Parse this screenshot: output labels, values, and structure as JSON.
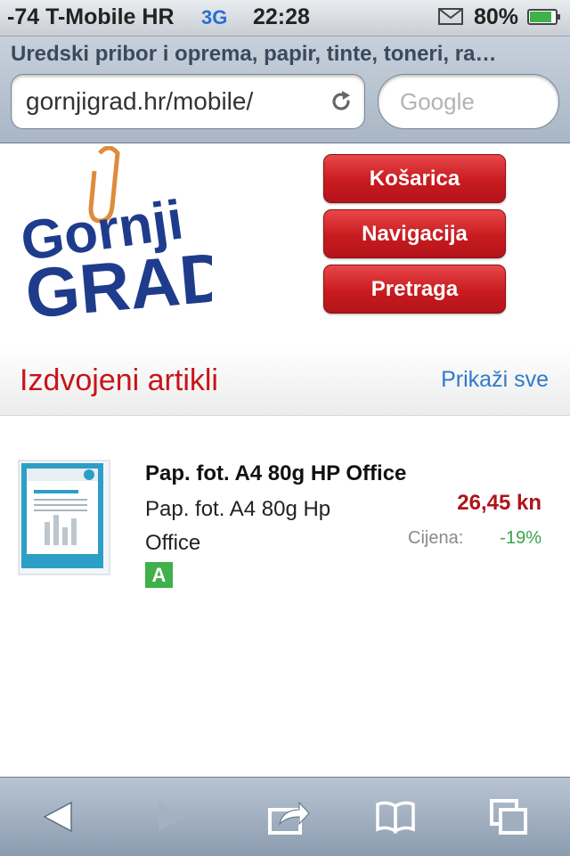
{
  "status_bar": {
    "carrier": "-74 T-Mobile HR",
    "network": "3G",
    "time": "22:28",
    "battery": "80%"
  },
  "browser": {
    "page_title": "Uredski pribor i oprema, papir, tinte, toneri, ra…",
    "url": "gornjigrad.hr/mobile/",
    "search_placeholder": "Google"
  },
  "header": {
    "logo_text": "Gornji GRAD",
    "buttons": [
      "Košarica",
      "Navigacija",
      "Pretraga"
    ]
  },
  "featured": {
    "title": "Izdvojeni artikli",
    "show_all": "Prikaži sve"
  },
  "products": [
    {
      "name": "Pap. fot. A4 80g HP Office",
      "description": "Pap. fot. A4 80g Hp Office",
      "price": "26,45 kn",
      "price_label": "Cijena:",
      "discount": "-19%",
      "badge": "A"
    }
  ],
  "colors": {
    "accent_red": "#c8141a",
    "link_blue": "#2f7ac9",
    "discount_green": "#3aa34a",
    "logo_blue": "#1f3c8c"
  },
  "toolbar_icons": [
    "back-icon",
    "forward-icon",
    "share-icon",
    "bookmarks-icon",
    "tabs-icon"
  ]
}
